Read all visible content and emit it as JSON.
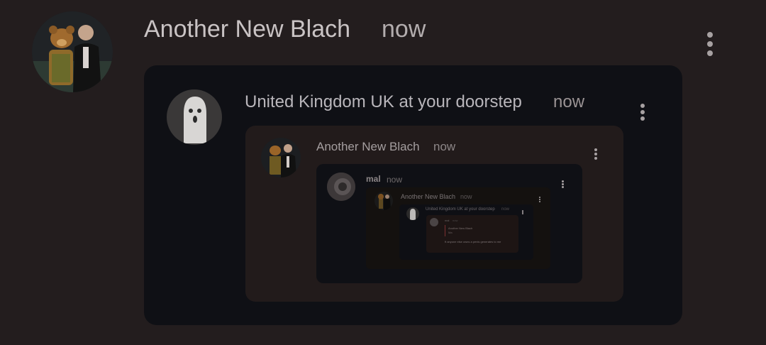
{
  "post": {
    "author": "Another New Blach",
    "time": "now",
    "avatar_icon": "bear-and-man-photo",
    "menu_icon": "more-vertical-icon"
  },
  "quote1": {
    "author": "United Kingdom UK at your doorstep",
    "time": "now",
    "avatar_icon": "ghost-photo"
  },
  "quote2": {
    "author": "Another New Blach",
    "time": "now",
    "avatar_icon": "bear-and-man-photo"
  },
  "quote3": {
    "author": "mal",
    "time": "now",
    "avatar_icon": "dim-photo"
  },
  "quote4": {
    "author": "Another New Blach",
    "time": "now"
  },
  "quote5": {
    "author": "United Kingdom UK at your doorstep",
    "time": "now"
  },
  "quote6": {
    "author": "mal",
    "time": "now",
    "inner_title": "Another New Blach",
    "inner_sub": "Ma",
    "body": "ft anyone else owns a penis generates to me"
  },
  "colors": {
    "background": "#231d1e",
    "card_dark": "#0f1015",
    "card_brown": "#221b1b"
  }
}
